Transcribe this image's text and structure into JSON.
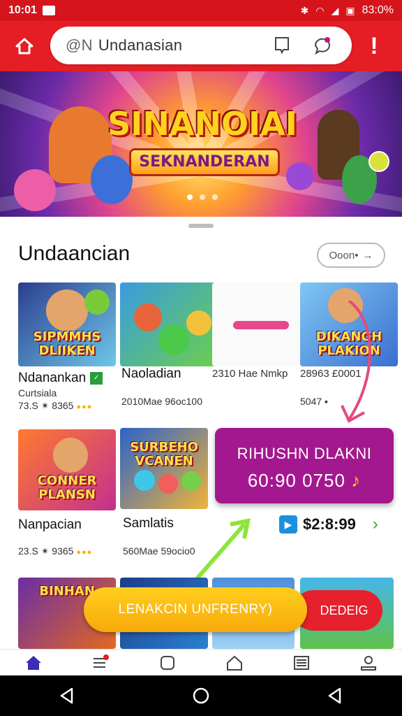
{
  "status_bar": {
    "time": "10:01",
    "battery": "83:0%"
  },
  "search": {
    "prefix": "@N",
    "query": "Undanasian"
  },
  "alert_label": "!",
  "banner": {
    "title": "SINANOIAI",
    "subtitle": "SEKNANDERAN",
    "slides": 3,
    "active_slide": 0
  },
  "section": {
    "title": "Undaancian",
    "more_label": "Ooon•"
  },
  "items": [
    {
      "name": "Ndanankan",
      "sub": "Curtsiala",
      "meta": "73.S ✴ 8365",
      "tile_title": "SIPMMHS DLIIKEN",
      "c1": "#2c3e8f",
      "c2": "#6ec7e8"
    },
    {
      "name": "Naoladian",
      "sub": "",
      "meta": "2010Mae 96oc100",
      "tile_title": "",
      "c1": "#3a9be0",
      "c2": "#6bcf4b"
    },
    {
      "name": "2310 Hae Nmkp",
      "sub": "",
      "meta": "",
      "tile_title": "",
      "c1": "#ffffff",
      "c2": "#f2f2f2"
    },
    {
      "name": "28963 £0001",
      "sub": "",
      "meta": "5047 ▪",
      "tile_title": "DIKANGH PLAKION",
      "c1": "#7fc7f2",
      "c2": "#3b6fd1"
    },
    {
      "name": "Nanpacian",
      "sub": "",
      "meta": "23.S ✴ 9365",
      "tile_title": "CONNER PLANSN",
      "c1": "#ff7a2f",
      "c2": "#c2308f"
    },
    {
      "name": "Samlatis",
      "sub": "",
      "meta": "560Mae 59ocio0",
      "tile_title": "SURBEHO VCANEN",
      "c1": "#2b63c9",
      "c2": "#f0b33a"
    }
  ],
  "promo": {
    "line1": "RIHUSHN DLAKNI",
    "line2": "60:90 0750",
    "note": "♪"
  },
  "price": "$2:8:99",
  "cta": {
    "primary": "LENAKCIN UNFRENRY)",
    "secondary": "DEDEIG"
  },
  "bottom_row_title": "BINHAN"
}
